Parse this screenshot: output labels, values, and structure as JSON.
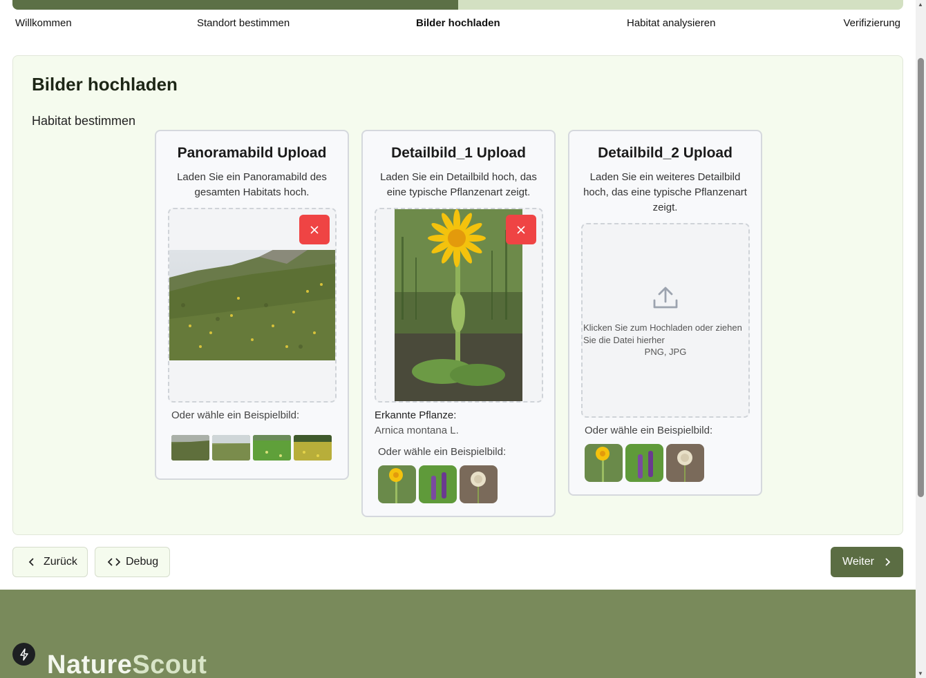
{
  "progress": {
    "fraction": 0.5,
    "steps": [
      "Willkommen",
      "Standort bestimmen",
      "Bilder hochladen",
      "Habitat analysieren",
      "Verifizierung"
    ],
    "active_index": 2
  },
  "page": {
    "title": "Bilder hochladen",
    "subtitle": "Habitat bestimmen"
  },
  "cards": [
    {
      "title": "Panoramabild Upload",
      "description": "Laden Sie ein Panoramabild des gesamten Habitats hoch.",
      "remove_icon": "close-icon",
      "example_label": "Oder wähle ein Beispielbild:"
    },
    {
      "title": "Detailbild_1 Upload",
      "description": "Laden Sie ein Detailbild hoch, das eine typische Pflanzenart zeigt.",
      "remove_icon": "close-icon",
      "recognized_label": "Erkannte Pflanze:",
      "recognized_value": "Arnica montana L.",
      "example_label": "Oder wähle ein Beispielbild:"
    },
    {
      "title": "Detailbild_2 Upload",
      "description": "Laden Sie ein weiteres Detailbild hoch, das eine typische Pflanzenart zeigt.",
      "upload_icon": "upload-icon",
      "upload_text": "Klicken Sie zum Hochladen oder ziehen Sie die Datei hierher",
      "upload_formats": "PNG, JPG",
      "example_label": "Oder wähle ein Beispielbild:"
    }
  ],
  "buttons": {
    "back": "Zurück",
    "debug": "Debug",
    "next": "Weiter"
  },
  "footer": {
    "brand_part1": "Nature",
    "brand_part2": "Scout"
  },
  "colors": {
    "primary": "#5b6d43",
    "progress_track": "#d3e0c2",
    "footer": "#798a5b",
    "danger": "#ef4444",
    "card_bg": "#f5fbee"
  }
}
